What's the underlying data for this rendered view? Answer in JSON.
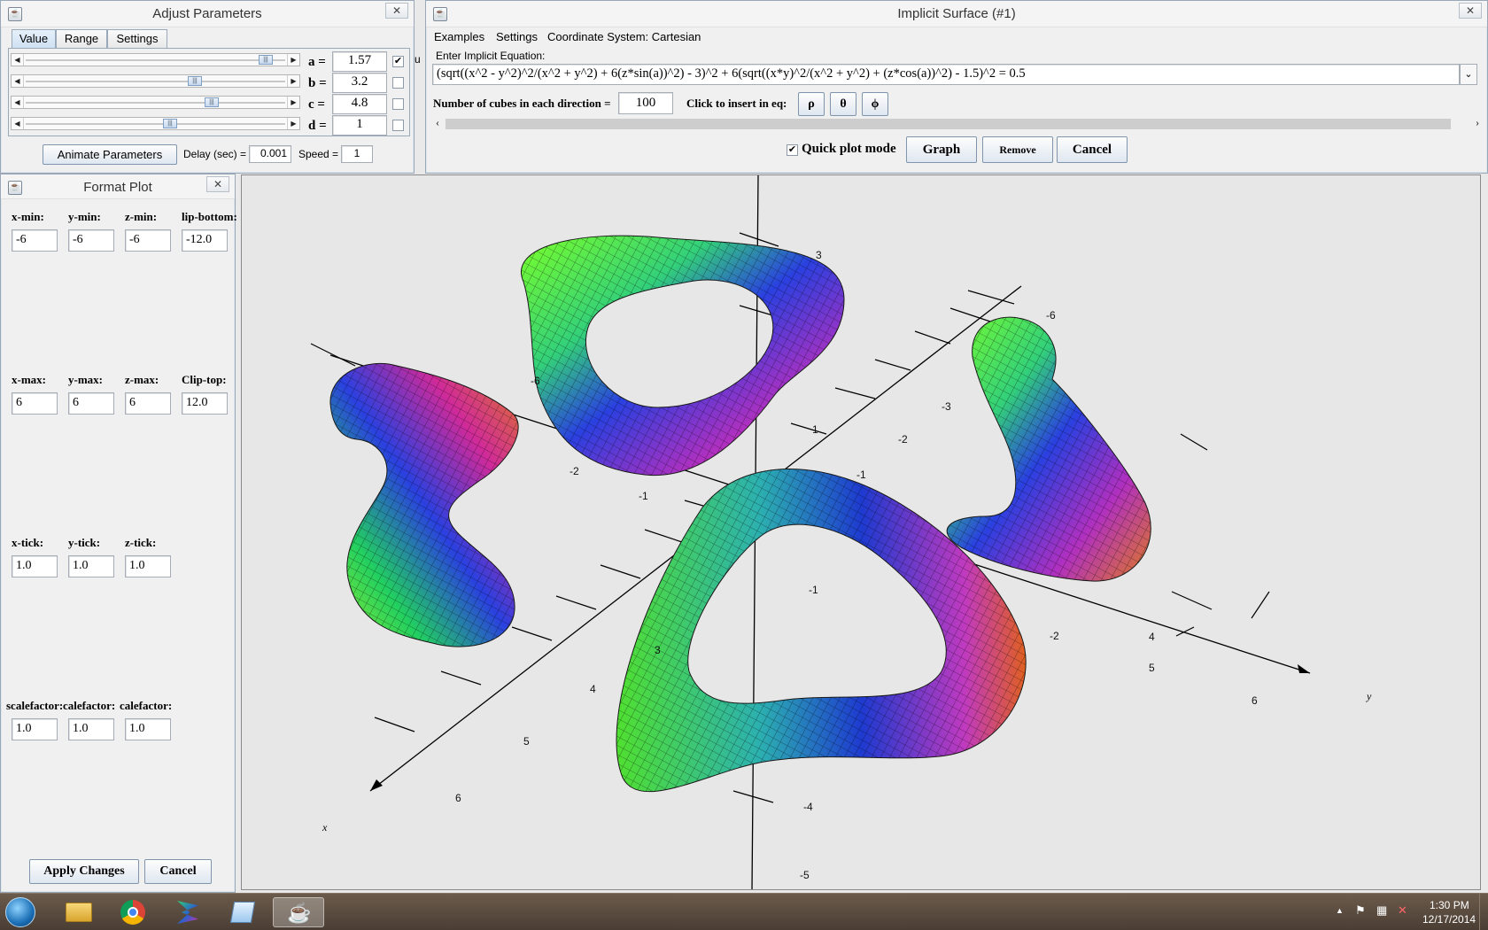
{
  "adjust_window": {
    "title": "Adjust Parameters",
    "tabs": [
      "Value",
      "Range",
      "Settings"
    ],
    "params": [
      {
        "name": "a =",
        "value": "1.57",
        "checked": true,
        "level": 0.95
      },
      {
        "name": "b =",
        "value": "3.2",
        "checked": false,
        "level": 0.66
      },
      {
        "name": "c =",
        "value": "4.8",
        "checked": false,
        "level": 0.73
      },
      {
        "name": "d =",
        "value": "1",
        "checked": false,
        "level": 0.56
      }
    ],
    "animate_label": "Animate Parameters",
    "delay_label": "Delay (sec) =",
    "delay_value": "0.001",
    "speed_label": "Speed =",
    "speed_value": "1",
    "partial_label": "u"
  },
  "format_window": {
    "title": "Format Plot",
    "row1_labels": [
      "x-min:",
      "y-min:",
      "z-min:",
      "lip-bottom:"
    ],
    "row1_values": [
      "-6",
      "-6",
      "-6",
      "-12.0"
    ],
    "row2_labels": [
      "x-max:",
      "y-max:",
      "z-max:",
      "Clip-top:"
    ],
    "row2_values": [
      "6",
      "6",
      "6",
      "12.0"
    ],
    "row3_labels": [
      "x-tick:",
      "y-tick:",
      "z-tick:"
    ],
    "row3_values": [
      "1.0",
      "1.0",
      "1.0"
    ],
    "row4_labels": [
      "scalefactor:",
      "calefactor:",
      "calefactor:"
    ],
    "row4_values": [
      "1.0",
      "1.0",
      "1.0"
    ],
    "apply_label": "Apply Changes",
    "cancel_label": "Cancel"
  },
  "implicit_window": {
    "title": "Implicit Surface (#1)",
    "menu": [
      "Examples",
      "Settings",
      "Coordinate System: Cartesian"
    ],
    "enter_label": "Enter Implicit Equation:",
    "equation": "(sqrt((x^2 - y^2)^2/(x^2 + y^2) + 6(z*sin(a))^2) - 3)^2 + 6(sqrt((x*y)^2/(x^2 + y^2) + (z*cos(a))^2) - 1.5)^2 = 0.5",
    "cubes_label": "Number of cubes in each direction =",
    "cubes_value": "100",
    "insert_label": "Click to insert in eq:",
    "symbols": [
      "ρ",
      "θ",
      "ϕ"
    ],
    "quick_plot_label": "Quick plot mode",
    "quick_plot_checked": true,
    "graph_label": "Graph",
    "remove_label": "Remove",
    "cancel_label": "Cancel"
  },
  "plot": {
    "axis_labels": {
      "x": "x",
      "y": "y"
    },
    "ticks": [
      "3",
      "-6",
      "-6",
      "1",
      "-3",
      "-2",
      "-1",
      "-2",
      "-1",
      "-1",
      "3",
      "-2",
      "4",
      "4",
      "5",
      "5",
      "6",
      "6",
      "-4",
      "-5"
    ]
  },
  "taskbar": {
    "time": "1:30 PM",
    "date": "12/17/2014",
    "apps": [
      "start-orb",
      "file-explorer",
      "chrome",
      "graph-app",
      "notepad",
      "java"
    ]
  }
}
